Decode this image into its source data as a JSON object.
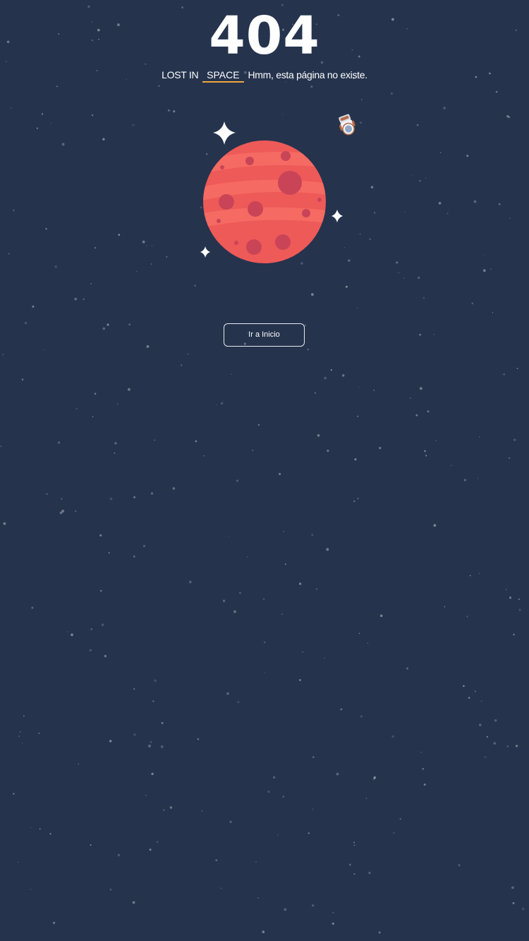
{
  "error": {
    "code": "404",
    "lost_label": "LOST IN",
    "space_label": "SPACE",
    "message": "Hmm, esta página no existe."
  },
  "actions": {
    "home_label": "Ir a Inicio"
  },
  "colors": {
    "background": "#25334d",
    "accent_underline": "#f0a640",
    "planet": "#ee5a58",
    "crater": "#c94457",
    "star": "#ffffff"
  },
  "illustration": {
    "planet": "red-planet-with-craters",
    "astronaut": "astronaut-icon",
    "sparkles": "sparkle-icon"
  }
}
